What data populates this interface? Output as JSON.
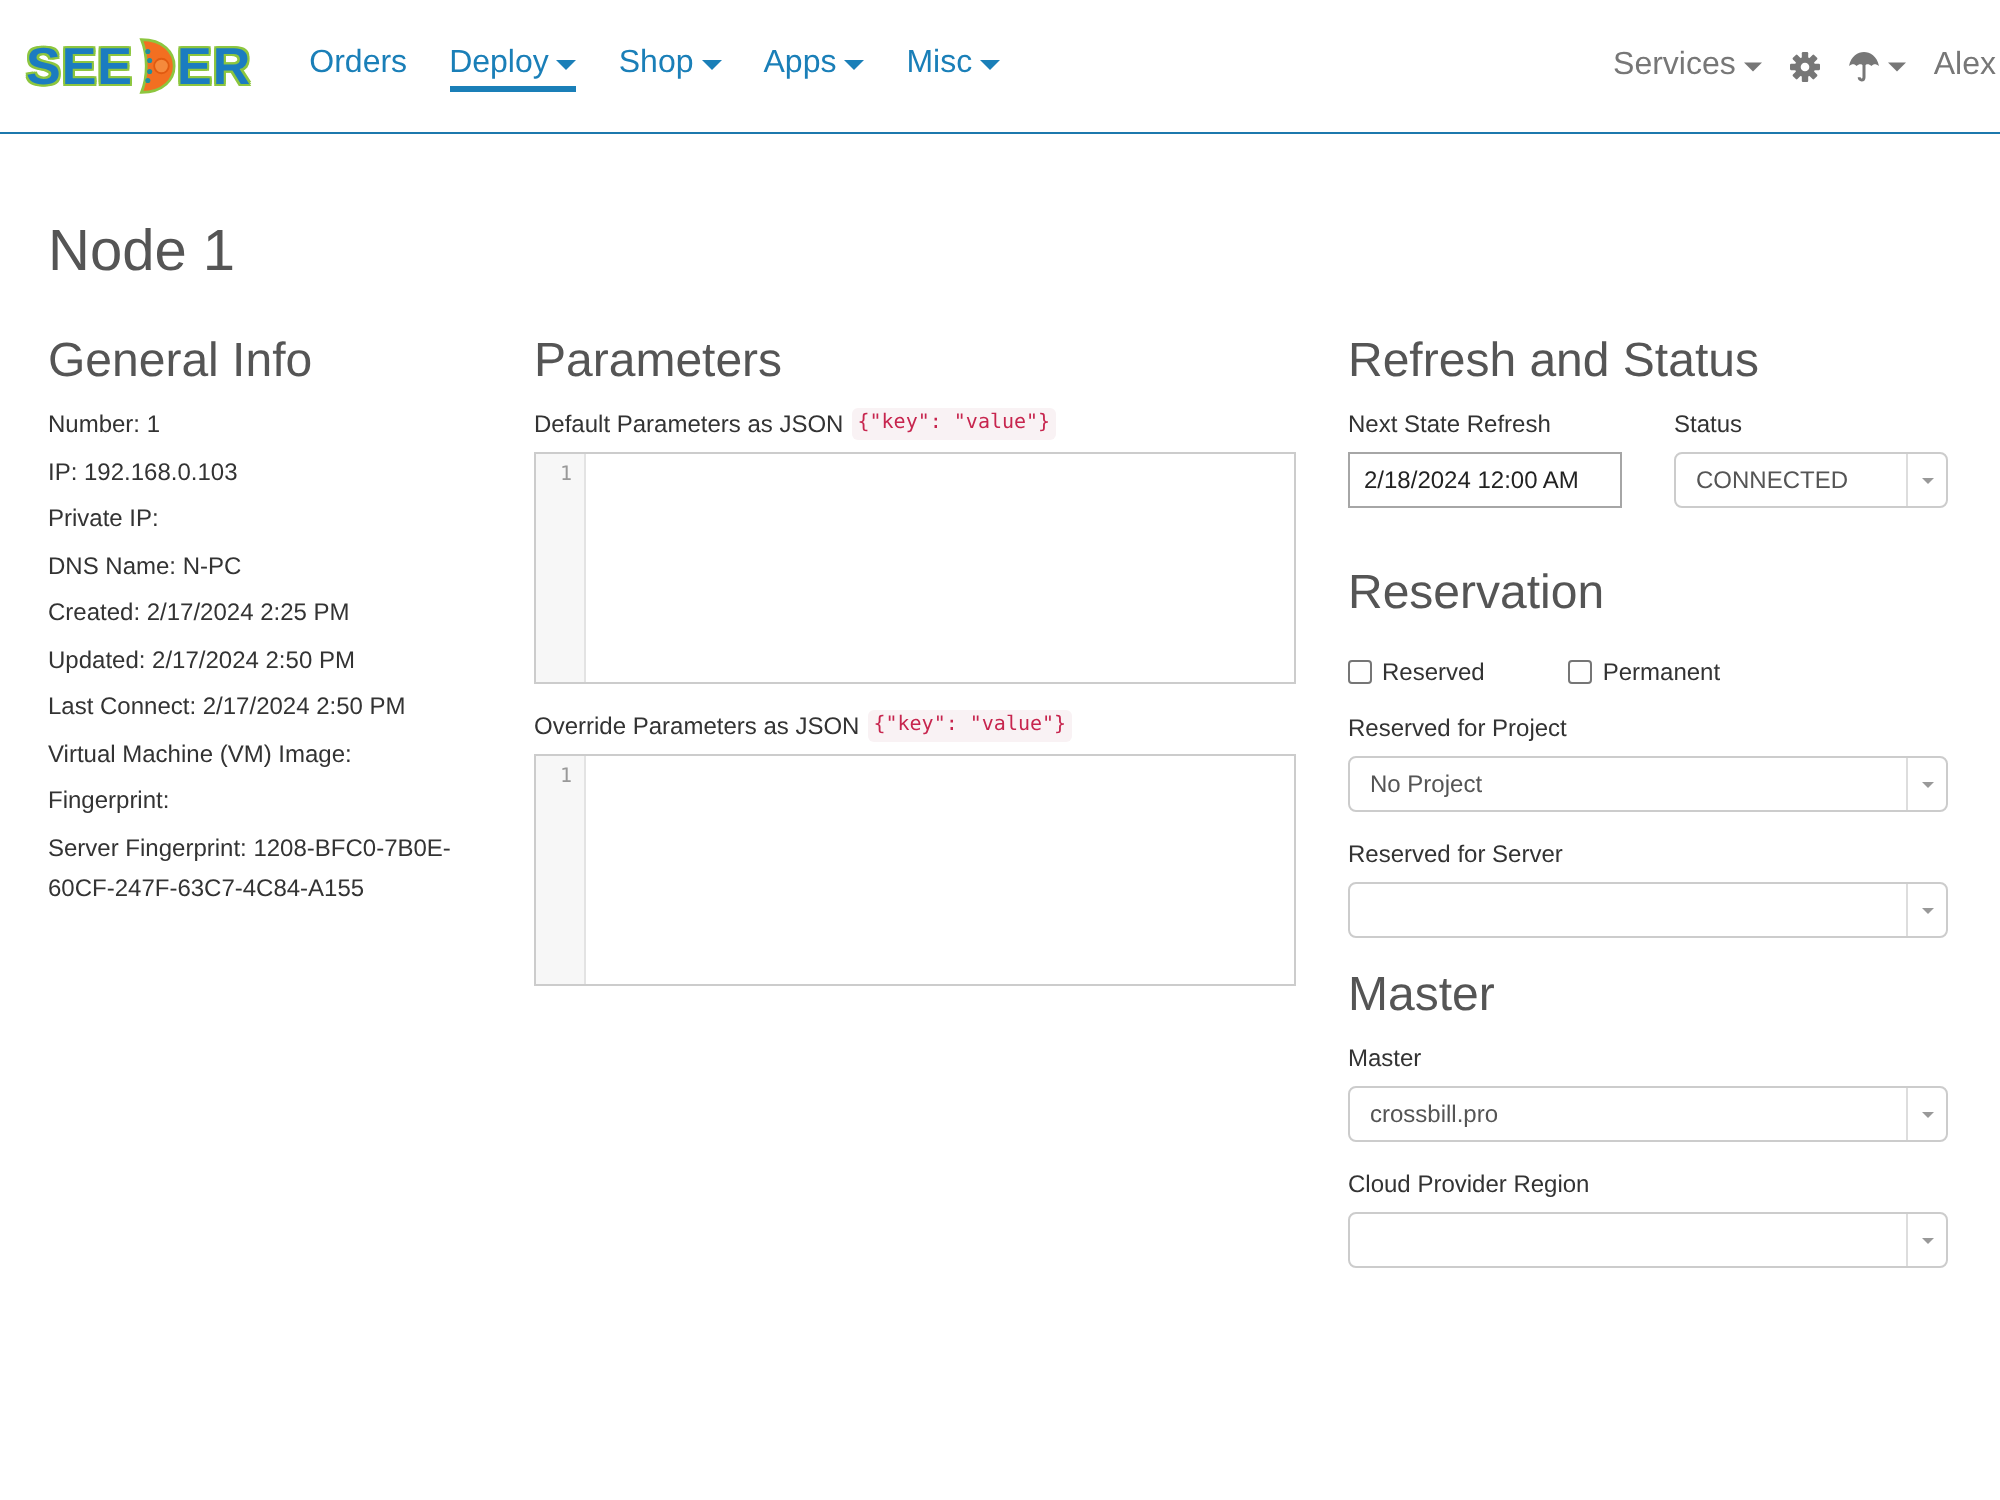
{
  "navbar": {
    "logo": {
      "before": "SEE",
      "after": "ER"
    },
    "items": [
      {
        "label": "Orders",
        "dropdown": false,
        "selected": false
      },
      {
        "label": "Deploy",
        "dropdown": true,
        "selected": true
      },
      {
        "label": "Shop",
        "dropdown": true,
        "selected": false
      },
      {
        "label": "Apps",
        "dropdown": true,
        "selected": false
      },
      {
        "label": "Misc",
        "dropdown": true,
        "selected": false
      }
    ],
    "right_items": [
      {
        "kind": "text",
        "label": "Services",
        "dropdown": true
      },
      {
        "kind": "gear",
        "dropdown": false
      },
      {
        "kind": "umbrella",
        "dropdown": true
      },
      {
        "kind": "text",
        "label": "Alex",
        "dropdown": false
      }
    ]
  },
  "page": {
    "title": "Node 1"
  },
  "general_info": {
    "title": "General Info",
    "items": [
      "Number: 1",
      "IP: 192.168.0.103",
      "Private IP:",
      "DNS Name: N-PC",
      "Created: 2/17/2024 2:25 PM",
      "Updated: 2/17/2024 2:50 PM",
      "Last Connect: 2/17/2024 2:50 PM",
      "Virtual Machine (VM) Image:",
      "Fingerprint:",
      "Server Fingerprint: 1208-BFC0-7B0E-60CF-247F-63C7-4C84-A155"
    ]
  },
  "parameters": {
    "title": "Parameters",
    "editors": [
      {
        "label": "Default Parameters as JSON",
        "hint": "{\"key\": \"value\"}",
        "line_number": "1"
      },
      {
        "label": "Override Parameters as JSON",
        "hint": "{\"key\": \"value\"}",
        "line_number": "1"
      }
    ]
  },
  "refresh_status": {
    "title": "Refresh and Status",
    "fields": [
      {
        "kind": "input",
        "label": "Next State Refresh",
        "value": "2/18/2024 12:00 AM"
      },
      {
        "kind": "select",
        "label": "Status",
        "value": "CONNECTED"
      }
    ]
  },
  "reservation": {
    "title": "Reservation",
    "checkboxes": [
      {
        "label": "Reserved",
        "checked": false
      },
      {
        "label": "Permanent",
        "checked": false
      }
    ],
    "fields": [
      {
        "kind": "select",
        "label": "Reserved for Project",
        "value": "No Project"
      },
      {
        "kind": "select",
        "label": "Reserved for Server"
      }
    ]
  },
  "master": {
    "title": "Master",
    "fields": [
      {
        "kind": "select",
        "label": "Master",
        "value": "crossbill.pro"
      },
      {
        "kind": "select",
        "label": "Cloud Provider Region"
      }
    ]
  }
}
